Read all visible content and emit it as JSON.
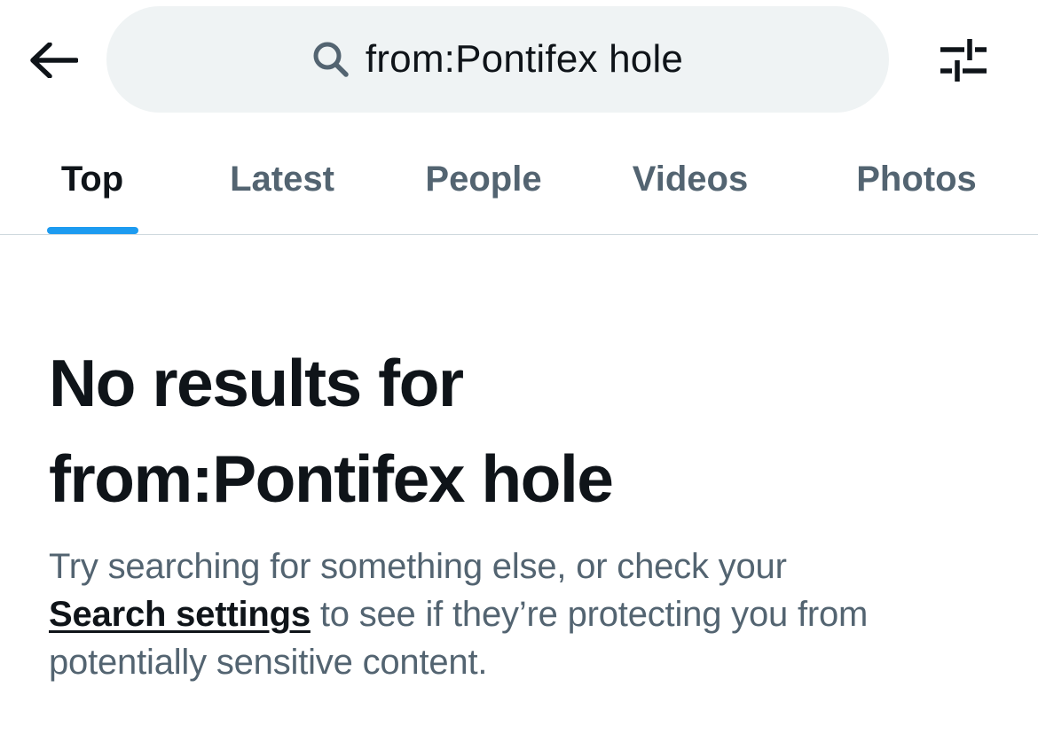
{
  "header": {
    "back_icon": "arrow-left-icon",
    "search": {
      "icon": "search-icon",
      "query": "from:Pontifex hole"
    },
    "filter_icon": "sliders-icon"
  },
  "tabs": [
    {
      "label": "Top",
      "active": true
    },
    {
      "label": "Latest",
      "active": false
    },
    {
      "label": "People",
      "active": false
    },
    {
      "label": "Videos",
      "active": false
    },
    {
      "label": "Photos",
      "active": false
    }
  ],
  "empty_state": {
    "title_line1": "No results for",
    "title_line2": "from:Pontifex hole",
    "body_line1": "Try searching for something else, or check your",
    "settings_link": "Search settings",
    "body_line2_rest": " to see if they’re protecting you from",
    "body_line3": "potentially sensitive content."
  },
  "colors": {
    "accent": "#1d9bf0",
    "text_primary": "#0f1419",
    "text_secondary": "#536471",
    "search_bg": "#eff3f4",
    "divider": "#cfd9de"
  }
}
